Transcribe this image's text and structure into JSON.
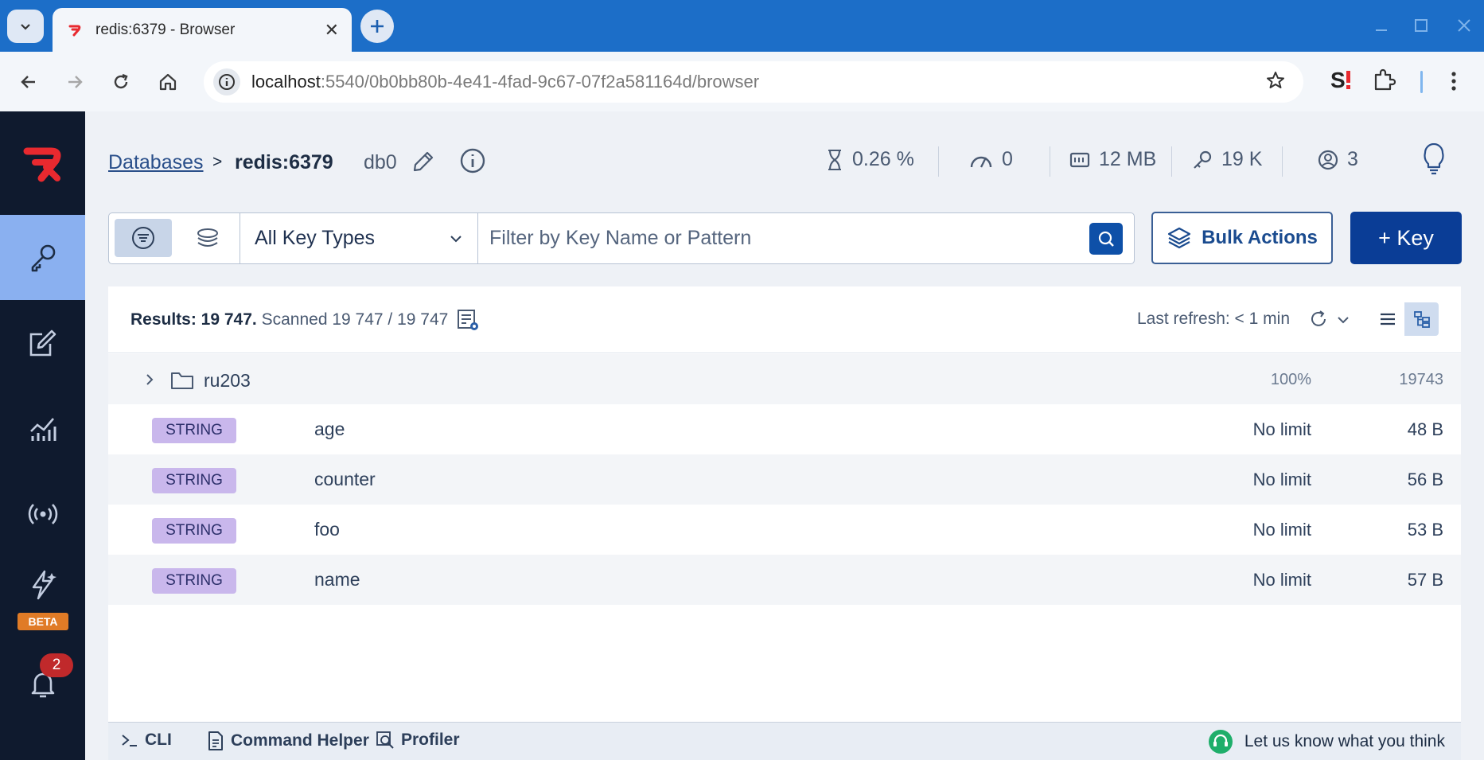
{
  "browser": {
    "tab_title": "redis:6379 - Browser",
    "url_host": "localhost",
    "url_rest": ":5540/0b0bb80b-4e41-4fad-9c67-07f2a581164d/browser"
  },
  "sidebar": {
    "items": [
      {
        "name": "browser",
        "icon": "key-icon",
        "active": true
      },
      {
        "name": "workbench",
        "icon": "edit-icon"
      },
      {
        "name": "analytics",
        "icon": "chart-icon"
      },
      {
        "name": "pubsub",
        "icon": "broadcast-icon"
      },
      {
        "name": "triggers",
        "icon": "bolt-icon"
      }
    ],
    "beta_label": "BETA",
    "notification_count": "2"
  },
  "header": {
    "databases_link": "Databases",
    "separator": ">",
    "current_db": "redis:6379",
    "db_index": "db0",
    "stats": {
      "cpu": "0.26 %",
      "ops": "0",
      "memory": "12 MB",
      "keys": "19 K",
      "clients": "3"
    }
  },
  "toolbar": {
    "key_type_selected": "All Key Types",
    "search_placeholder": "Filter by Key Name or Pattern",
    "bulk_actions_label": "Bulk Actions",
    "add_key_label": "+ Key"
  },
  "results": {
    "results_label": "Results: 19 747.",
    "scanned_label": "Scanned 19 747 / 19 747",
    "last_refresh": "Last refresh: < 1 min"
  },
  "folder": {
    "name": "ru203",
    "percent": "100%",
    "count": "19743"
  },
  "keys": [
    {
      "type": "STRING",
      "name": "age",
      "ttl": "No limit",
      "size": "48 B"
    },
    {
      "type": "STRING",
      "name": "counter",
      "ttl": "No limit",
      "size": "56 B"
    },
    {
      "type": "STRING",
      "name": "foo",
      "ttl": "No limit",
      "size": "53 B"
    },
    {
      "type": "STRING",
      "name": "name",
      "ttl": "No limit",
      "size": "57 B"
    }
  ],
  "bottom_bar": {
    "cli_label": "CLI",
    "command_helper_label": "Command Helper",
    "profiler_label": "Profiler",
    "feedback_label": "Let us know what you think"
  },
  "colors": {
    "sidebar_bg": "#0f1a2e",
    "sidebar_active": "#8ab0f0",
    "primary_button": "#0a3d96",
    "string_badge": "#c9b7ec",
    "brand_red": "#e8292f"
  }
}
